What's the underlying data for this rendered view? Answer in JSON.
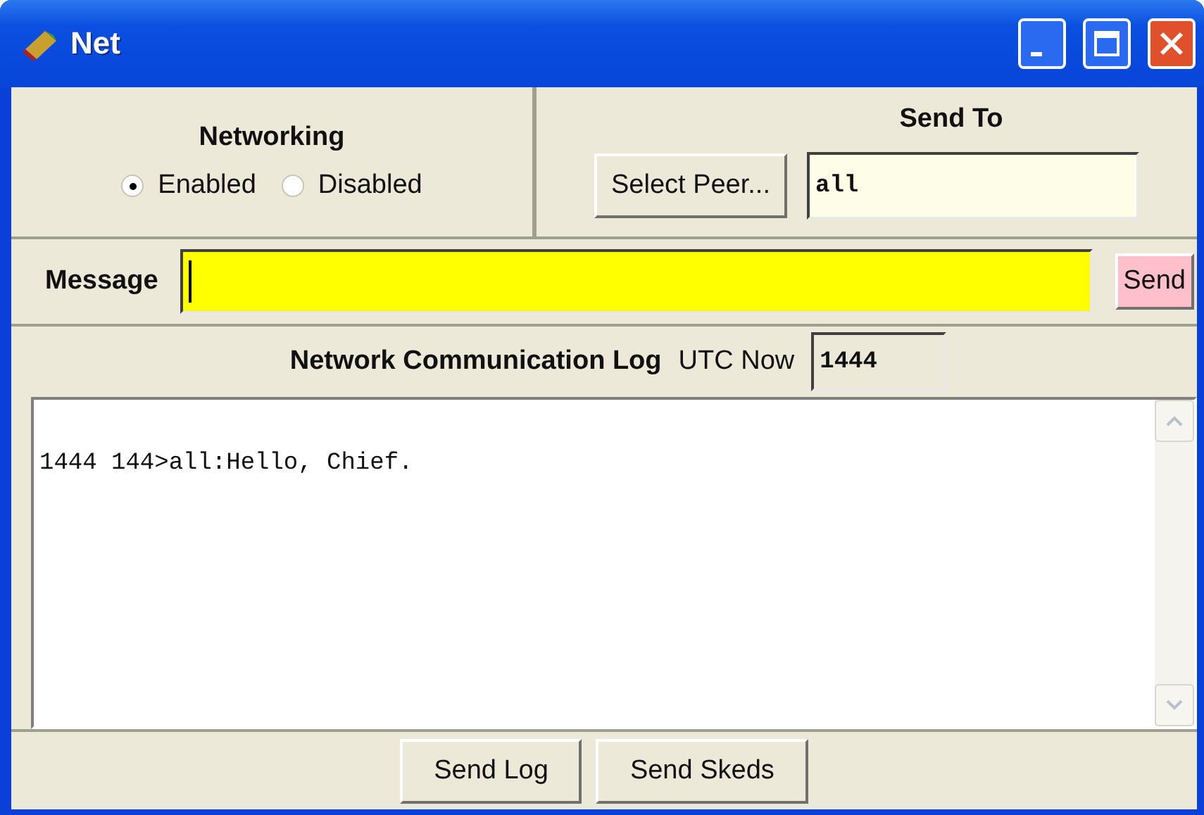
{
  "window": {
    "title": "Net"
  },
  "networking": {
    "label": "Networking",
    "options": [
      {
        "label": "Enabled",
        "selected": true
      },
      {
        "label": "Disabled",
        "selected": false
      }
    ]
  },
  "send_to": {
    "label": "Send To",
    "button": "Select Peer...",
    "value": "all"
  },
  "message": {
    "label": "Message",
    "button": "Send"
  },
  "log": {
    "title": "Network Communication Log",
    "utc_label": "UTC Now",
    "utc_value": "1444",
    "lines": [
      "1444 144>all:Hello, Chief."
    ]
  },
  "buttons": [
    "Send Log",
    "Send Skeds"
  ]
}
